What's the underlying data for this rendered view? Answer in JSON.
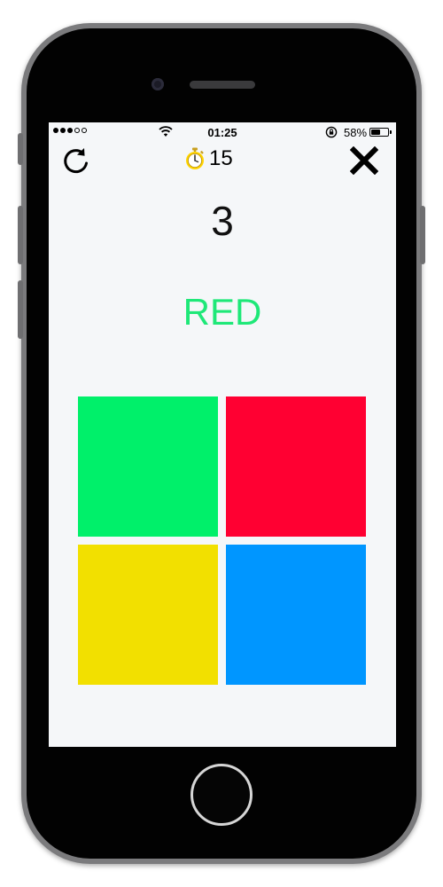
{
  "status_bar": {
    "signal": {
      "bars_total": 5,
      "bars_filled": 3,
      "icon": "signal-icon"
    },
    "wifi_icon": "wifi-icon",
    "time": "01:25",
    "orientation_lock_icon": "orientation-lock-icon",
    "battery_percent": "58%",
    "battery_level": 0.58
  },
  "toolbar": {
    "restart_icon": "restart-icon",
    "timer_icon": "stopwatch-icon",
    "timer_value": "15",
    "close_icon": "close-icon"
  },
  "game": {
    "score": "3",
    "word": "RED",
    "word_color": "#1ee878",
    "tiles": [
      {
        "name": "green",
        "color": "#00f06a"
      },
      {
        "name": "red",
        "color": "#ff0032"
      },
      {
        "name": "yellow",
        "color": "#f2e000"
      },
      {
        "name": "blue",
        "color": "#0096ff"
      }
    ]
  }
}
